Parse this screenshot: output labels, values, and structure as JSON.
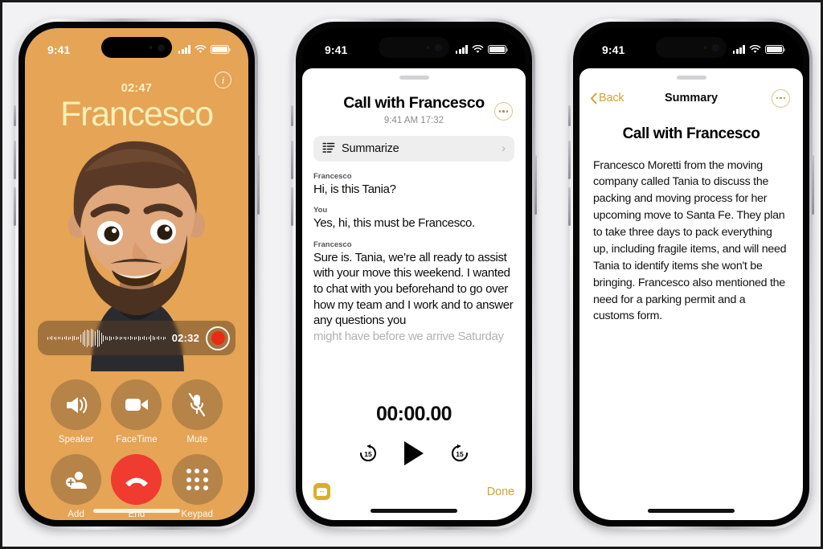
{
  "scene": {
    "background_color": "#f2f2f4",
    "border_color": "#1a1a1a"
  },
  "phone1": {
    "name": "call-screen",
    "status_bar": {
      "time": "9:41",
      "signal_icon": "cellular-bars-icon",
      "wifi_icon": "wifi-icon",
      "battery_icon": "battery-full-icon"
    },
    "accent_color": "#e5a456",
    "name_color": "#fbefb4",
    "info_button": "i",
    "call_timer": "02:47",
    "caller_name": "Francesco",
    "avatar": "memoji-avatar",
    "recording": {
      "time": "02:32",
      "record_button": "record-stop-button",
      "record_color": "#e82b16",
      "waveform": "audio-waveform"
    },
    "controls": [
      {
        "label": "Speaker",
        "icon": "speaker-icon"
      },
      {
        "label": "FaceTime",
        "icon": "video-camera-icon"
      },
      {
        "label": "Mute",
        "icon": "microphone-muted-icon"
      },
      {
        "label": "Add",
        "icon": "add-person-icon"
      },
      {
        "label": "End",
        "icon": "end-call-icon"
      },
      {
        "label": "Keypad",
        "icon": "keypad-icon"
      }
    ],
    "end_button_color": "#ef3b30"
  },
  "phone2": {
    "name": "call-transcript-sheet",
    "status_bar": {
      "time": "9:41",
      "signal_icon": "cellular-bars-icon",
      "wifi_icon": "wifi-icon",
      "battery_icon": "battery-full-icon"
    },
    "title": "Call with Francesco",
    "subtitle": "9:41 AM  17:32",
    "more_button": "more-options-icon",
    "summarize": {
      "label": "Summarize",
      "icon": "summarize-lines-icon",
      "chevron": "›"
    },
    "transcript": [
      {
        "speaker": "Francesco",
        "text": "Hi, is this Tania?"
      },
      {
        "speaker": "You",
        "text": "Yes, hi, this must be Francesco."
      },
      {
        "speaker": "Francesco",
        "text": "Sure is. Tania, we’re all ready to assist with your move this weekend. I wanted to chat with you beforehand to go over how my team and I work and to answer any questions you",
        "faded_tail": "might have before we arrive Saturday"
      }
    ],
    "player": {
      "time": "00:00.00",
      "back_label": "15",
      "forward_label": "15",
      "back_icon": "skip-back-15-icon",
      "play_icon": "play-icon",
      "forward_icon": "skip-forward-15-icon"
    },
    "footer": {
      "messages_icon": "messages-app-icon",
      "done_label": "Done",
      "done_color": "#cfa531"
    }
  },
  "phone3": {
    "name": "call-summary-sheet",
    "status_bar": {
      "time": "9:41",
      "signal_icon": "cellular-bars-icon",
      "wifi_icon": "wifi-icon",
      "battery_icon": "battery-full-icon"
    },
    "back_label": "Back",
    "nav_title": "Summary",
    "more_button": "more-options-icon",
    "heading": "Call with Francesco",
    "body": "Francesco Moretti from the moving company called Tania to discuss the packing and moving process for her upcoming move to Santa Fe. They plan to take three days to pack everything up, including fragile items, and will need Tania to identify items she won't be bringing. Francesco also mentioned the need for a parking permit and a customs form."
  }
}
